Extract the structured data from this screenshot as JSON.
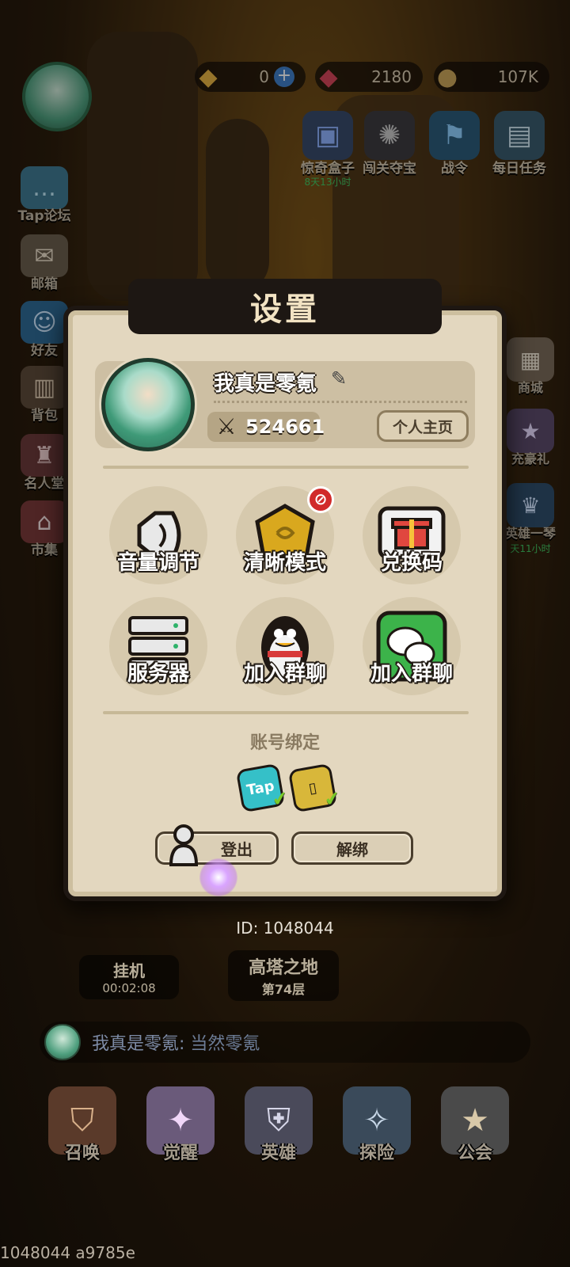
{
  "top": {
    "diamonds": "0",
    "gems": "2180",
    "coins": "107K"
  },
  "top_icons": [
    {
      "label": "惊奇盒子",
      "sub": "8天13小时",
      "icon": "box-icon"
    },
    {
      "label": "闯关夺宝",
      "sub": "",
      "icon": "beast-icon"
    },
    {
      "label": "战令",
      "sub": "",
      "icon": "flag-icon"
    },
    {
      "label": "每日任务",
      "sub": "",
      "icon": "book-icon"
    }
  ],
  "side_left": [
    {
      "label": "Tap论坛",
      "icon": "chat-icon"
    },
    {
      "label": "邮箱",
      "icon": "mail-icon"
    },
    {
      "label": "好友",
      "icon": "friend-icon"
    },
    {
      "label": "背包",
      "icon": "bag-icon"
    },
    {
      "label": "名人堂",
      "icon": "hall-icon"
    },
    {
      "label": "市集",
      "icon": "market-icon"
    }
  ],
  "side_right": [
    {
      "label": "商城",
      "sub": "",
      "icon": "shop-icon"
    },
    {
      "label": "充豪礼",
      "sub": "",
      "icon": "ssr-icon"
    },
    {
      "label": "英雄一琴",
      "sub": "天11小时",
      "icon": "hero-icon"
    }
  ],
  "dialog": {
    "title": "设置",
    "player_name": "我真是零氪",
    "power": "524661",
    "homepage_label": "个人主页",
    "settings": [
      {
        "label": "音量调节",
        "icon": "speaker-icon"
      },
      {
        "label": "清晰模式",
        "icon": "quality-icon"
      },
      {
        "label": "兑换码",
        "icon": "gift-icon"
      },
      {
        "label": "服务器",
        "icon": "server-icon"
      },
      {
        "label": "加入群聊",
        "icon": "qq-icon"
      },
      {
        "label": "加入群聊",
        "icon": "wechat-icon"
      }
    ],
    "bind_title": "账号绑定",
    "bind_tap": "Tap",
    "logout_label": "登出",
    "unbind_label": "解绑"
  },
  "lower": {
    "id_text": "ID: 1048044",
    "idle_title": "挂机",
    "idle_time": "00:02:08",
    "tower_title": "高塔之地",
    "tower_floor": "第74层",
    "chat_name": "我真是零氪:",
    "chat_msg": "当然零氪"
  },
  "nav": [
    {
      "label": "召唤",
      "icon": "summon-icon"
    },
    {
      "label": "觉醒",
      "icon": "awaken-icon"
    },
    {
      "label": "英雄",
      "icon": "hero-nav-icon"
    },
    {
      "label": "探险",
      "icon": "compass-icon"
    },
    {
      "label": "公会",
      "icon": "guild-icon"
    }
  ],
  "build_text": "1048044 a9785e"
}
